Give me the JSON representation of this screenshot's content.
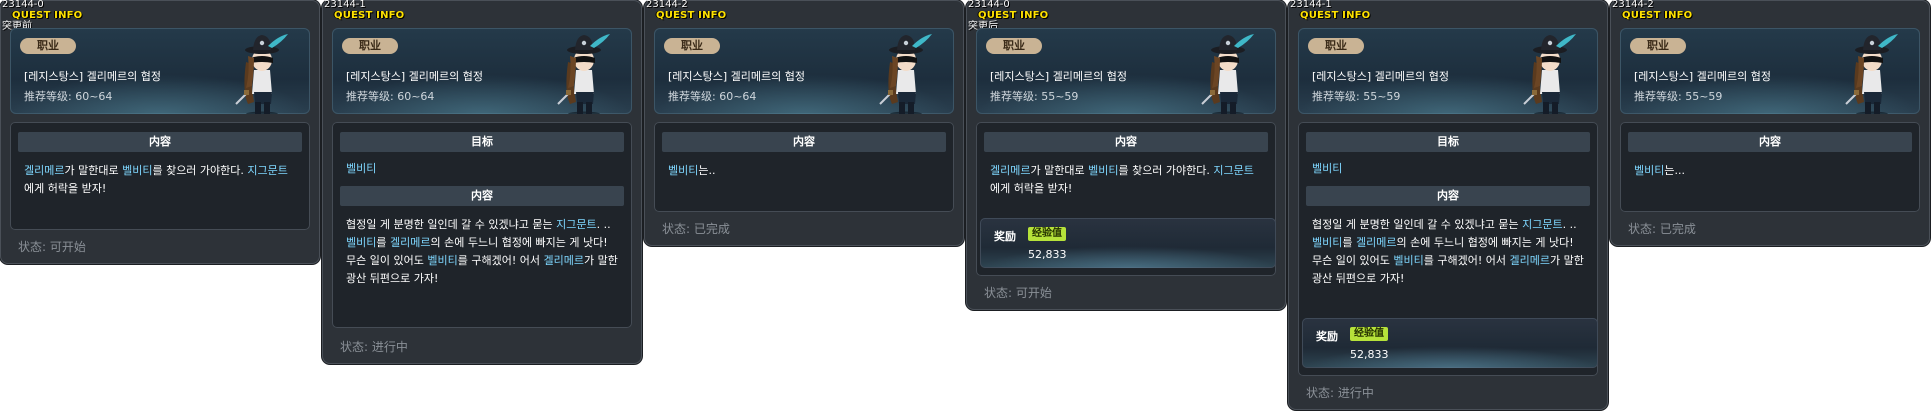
{
  "panels": [
    {
      "id": "23144-0",
      "title": "QUEST INFO",
      "subtitle": "突更前",
      "job": "职业",
      "name": "[레지스탕스] 겔리메르의 협정",
      "level": "推荐等级: 60~64",
      "section1": "内容",
      "body_parts": [
        {
          "t": "겔리메르",
          "h": true
        },
        {
          "t": "가 말한대로 ",
          "h": false
        },
        {
          "t": "벨비티",
          "h": true
        },
        {
          "t": "를 찾으러 가야한다. ",
          "h": false
        },
        {
          "t": "지그문트",
          "h": true
        },
        {
          "t": "에게 허락을 받자!",
          "h": false
        }
      ],
      "status": "状态: 可开始"
    },
    {
      "id": "23144-1",
      "title": "QUEST INFO",
      "job": "职业",
      "name": "[레지스탕스] 겔리메르의 협정",
      "level": "推荐等级: 60~64",
      "goal_label": "目标",
      "goal": "벨비티",
      "content_label": "内容",
      "body_parts": [
        {
          "t": "협정일 게 분명한 일인데 갈 수 있겠냐고 묻는 ",
          "h": false
        },
        {
          "t": "지그문트",
          "h": true
        },
        {
          "t": ". .. ",
          "h": false
        },
        {
          "t": "벨비티",
          "h": true
        },
        {
          "t": "를 ",
          "h": false
        },
        {
          "t": "겔리메르",
          "h": true
        },
        {
          "t": "의 손에 두느니 협정에 빠지는 게 낫다! 무슨 일이 있어도 ",
          "h": false
        },
        {
          "t": "벨비티",
          "h": true
        },
        {
          "t": "를 구해겠어! 어서 ",
          "h": false
        },
        {
          "t": "겔리메르",
          "h": true
        },
        {
          "t": "가 말한 광산 뒤편으로 가자!",
          "h": false
        }
      ],
      "status": "状态: 进行中"
    },
    {
      "id": "23144-2",
      "title": "QUEST INFO",
      "job": "职业",
      "name": "[레지스탕스] 겔리메르의 협정",
      "level": "推荐等级: 60~64",
      "section1": "内容",
      "body_parts": [
        {
          "t": "벨비티",
          "h": true
        },
        {
          "t": "는..",
          "h": false
        }
      ],
      "status": "状态: 已完成"
    },
    {
      "id": "23144-0",
      "title": "QUEST INFO",
      "subtitle": "突更后",
      "job": "职业",
      "name": "[레지스탕스] 겔리메르의 협정",
      "level": "推荐等级: 55~59",
      "section1": "内容",
      "body_parts": [
        {
          "t": "겔리메르",
          "h": true
        },
        {
          "t": "가 말한대로 ",
          "h": false
        },
        {
          "t": "벨비티",
          "h": true
        },
        {
          "t": "를 찾으러 가야한다. ",
          "h": false
        },
        {
          "t": "지그문트",
          "h": true
        },
        {
          "t": "에게 허락을 받자!",
          "h": false
        }
      ],
      "reward_label": "奖励",
      "exp_label": "经验值",
      "exp_value": "52,833",
      "status": "状态: 可开始"
    },
    {
      "id": "23144-1",
      "title": "QUEST INFO",
      "job": "职业",
      "name": "[레지스탕스] 겔리메르의 협정",
      "level": "推荐等级: 55~59",
      "goal_label": "目标",
      "goal": "벨비티",
      "content_label": "内容",
      "body_parts": [
        {
          "t": "협정일 게 분명한 일인데 갈 수 있겠냐고 묻는 ",
          "h": false
        },
        {
          "t": "지그문트",
          "h": true
        },
        {
          "t": ". .. ",
          "h": false
        },
        {
          "t": "벨비티",
          "h": true
        },
        {
          "t": "를 ",
          "h": false
        },
        {
          "t": "겔리메르",
          "h": true
        },
        {
          "t": "의 손에 두느니 협정에 빠지는 게 낫다! 무슨 일이 있어도 ",
          "h": false
        },
        {
          "t": "벨비티",
          "h": true
        },
        {
          "t": "를 구해겠어! 어서 ",
          "h": false
        },
        {
          "t": "겔리메르",
          "h": true
        },
        {
          "t": "가 말한 광산 뒤편으로 가자!",
          "h": false
        }
      ],
      "reward_label": "奖励",
      "exp_label": "经验值",
      "exp_value": "52,833",
      "status": "状态: 进行中"
    },
    {
      "id": "23144-2",
      "title": "QUEST INFO",
      "job": "职业",
      "name": "[레지스탕스] 겔리메르의 협정",
      "level": "推荐等级: 55~59",
      "section1": "内容",
      "body_parts": [
        {
          "t": "벨비티",
          "h": true
        },
        {
          "t": "는...",
          "h": false
        }
      ],
      "status": "状态: 已完成"
    }
  ],
  "colors": {
    "highlight": "#7fd7ff",
    "title": "#ffe200",
    "exp_badge": "#b6e23a"
  },
  "icons": {
    "character": "npc-character-icon"
  }
}
